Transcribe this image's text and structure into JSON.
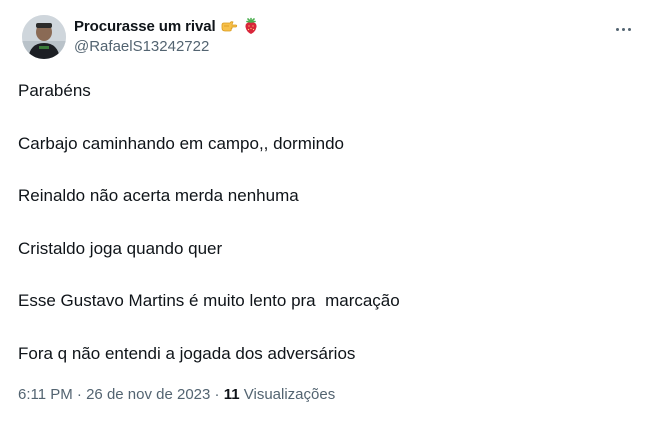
{
  "author": {
    "display_name": "Procurasse um rival",
    "emojis": [
      "backhand-index-pointing-right",
      "strawberry"
    ],
    "handle": "@RafaelS13242722"
  },
  "tweet": {
    "lines": [
      "Parabéns",
      "Carbajo caminhando em campo,, dormindo",
      "Reinaldo não acerta merda nenhuma",
      "Cristaldo joga quando quer",
      "Esse Gustavo Martins é muito lento pra  marcação",
      "Fora q não entendi a jogada dos adversários"
    ]
  },
  "meta": {
    "time": "6:11 PM",
    "separator": " · ",
    "date": "26 de nov de 2023",
    "views_count": "11",
    "views_label": "Visualizações"
  },
  "colors": {
    "text_primary": "#0f1419",
    "text_secondary": "#536471",
    "background": "#ffffff"
  }
}
